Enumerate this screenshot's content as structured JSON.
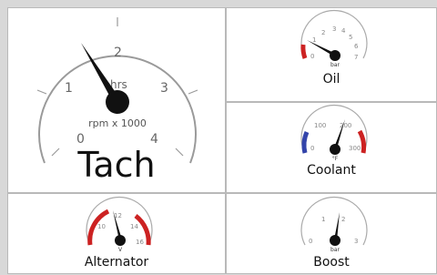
{
  "gauges": {
    "tach": {
      "title": "Tach",
      "unit": "rpm x 1000",
      "subunit": "hrs",
      "ticks": [
        "0",
        "1",
        "2",
        "3",
        "4"
      ],
      "value": 1.1
    },
    "oil": {
      "title": "Oil",
      "unit": "bar",
      "ticks": [
        "0",
        "1",
        "2",
        "3",
        "4",
        "5",
        "6",
        "7"
      ],
      "value": 0.6
    },
    "coolant": {
      "title": "Coolant",
      "unit": "°F",
      "ticks": [
        "0",
        "100",
        "200",
        "300"
      ],
      "value": 220
    },
    "alternator": {
      "title": "Alternator",
      "unit": "V",
      "ticks": [
        "10",
        "12",
        "14",
        "16"
      ],
      "value": 12.2
    },
    "boost": {
      "title": "Boost",
      "unit": "bar",
      "ticks": [
        "0",
        "1",
        "2",
        "3"
      ],
      "value": 1.8
    }
  },
  "colors": {
    "redline": "#cc2222",
    "cold": "#3344aa",
    "needle": "#111111",
    "arc": "#9a9a9a"
  }
}
